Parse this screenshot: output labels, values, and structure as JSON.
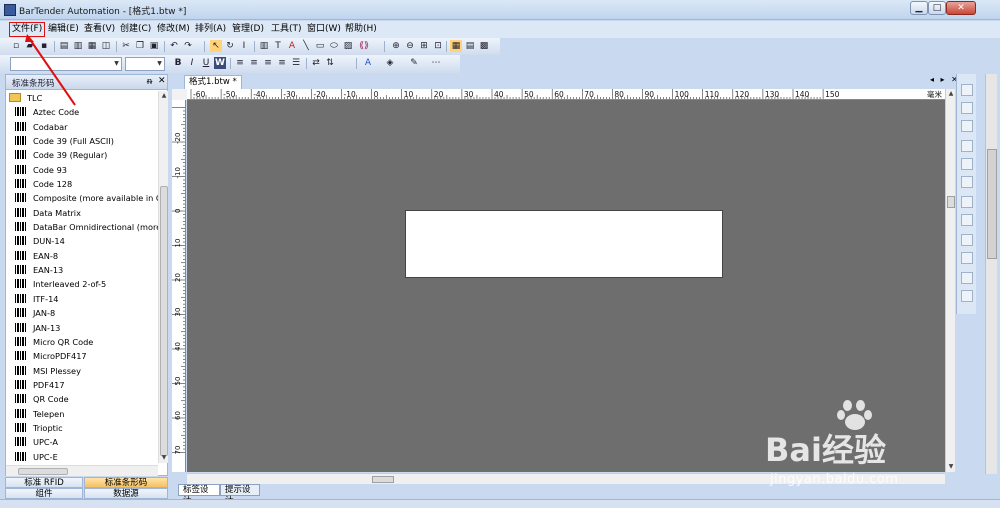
{
  "window": {
    "title": "BarTender Automation - [格式1.btw *]"
  },
  "window_controls": {
    "minimize": "▁",
    "maximize": "□",
    "close": "✕"
  },
  "menu": [
    "文件(F)",
    "编辑(E)",
    "查看(V)",
    "创建(C)",
    "修改(M)",
    "排列(A)",
    "管理(D)",
    "工具(T)",
    "窗口(W)",
    "帮助(H)"
  ],
  "toolbar2": {
    "font_name": "",
    "font_size": "",
    "bold": "B",
    "italic": "I",
    "underline": "U",
    "wordart": "W"
  },
  "left_panel": {
    "title": "标准条形码",
    "pin": "ᵰ",
    "close": "✕",
    "folder": "TLC",
    "items": [
      "Aztec Code",
      "Codabar",
      "Code 39 (Full ASCII)",
      "Code 39 (Regular)",
      "Code 93",
      "Code 128",
      "Composite (more available in GS",
      "Data Matrix",
      "DataBar Omnidirectional (more a",
      "DUN-14",
      "EAN-8",
      "EAN-13",
      "Interleaved 2-of-5",
      "ITF-14",
      "JAN-8",
      "JAN-13",
      "Micro QR Code",
      "MicroPDF417",
      "MSI Plessey",
      "PDF417",
      "QR Code",
      "Telepen",
      "Trioptic",
      "UPC-A",
      "UPC-E"
    ]
  },
  "bottom_tabs": {
    "rfid": "标准 RFID",
    "barcode": "标准条形码",
    "components": "组件",
    "datasource": "数据源"
  },
  "document": {
    "tab": "格式1.btw *",
    "nav": "◂ ▸ ✕"
  },
  "ruler": {
    "h_labels": [
      "-60",
      "-50",
      "-40",
      "-30",
      "-20",
      "-10",
      "0",
      "10",
      "20",
      "30",
      "40",
      "50",
      "60",
      "70",
      "80",
      "90",
      "100",
      "110",
      "120",
      "130",
      "140",
      "150"
    ],
    "h_unit": "毫米",
    "v_labels": [
      "-20",
      "-10",
      "0",
      "10",
      "20",
      "30",
      "40",
      "50",
      "60",
      "70"
    ]
  },
  "view_tabs": {
    "design": "标签设计",
    "prompt": "提示设计"
  },
  "watermark": {
    "brand": "Bai经验",
    "url": "jingyan.baidu.com"
  }
}
